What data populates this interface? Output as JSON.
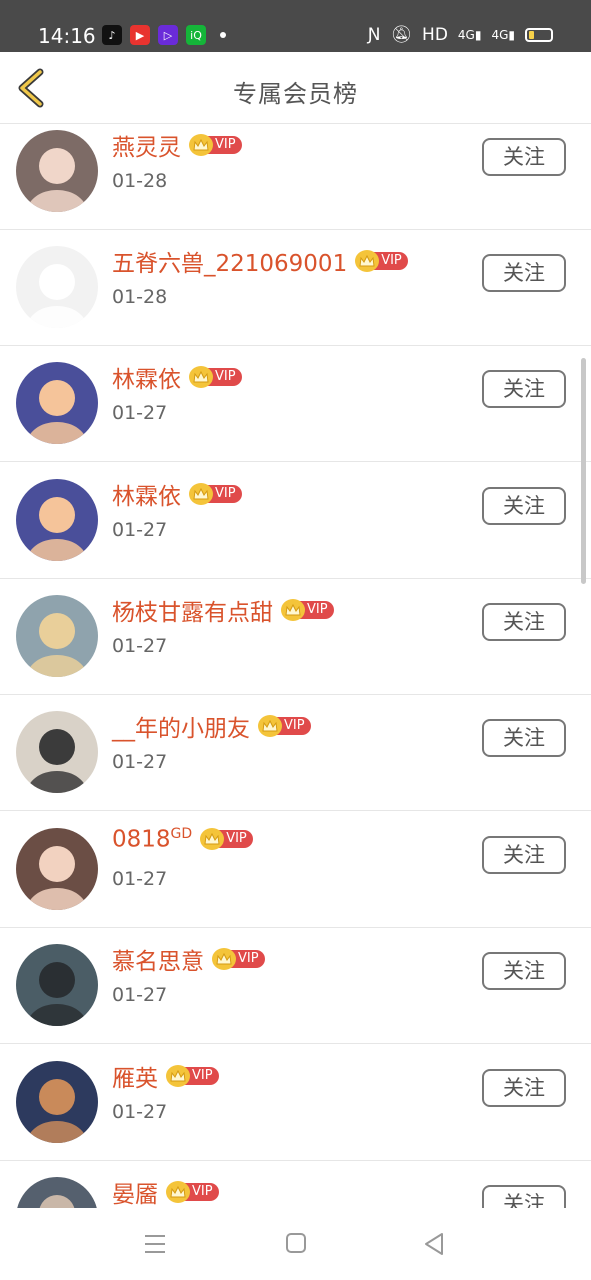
{
  "status": {
    "time": "14:16",
    "apps": [
      {
        "icon": "tiktok-icon",
        "color": "#111111",
        "glyph": "♪"
      },
      {
        "icon": "video-app-icon",
        "color": "#e8332f",
        "glyph": "▶"
      },
      {
        "icon": "music-app-icon",
        "color": "#6a2bd9",
        "glyph": "▷"
      },
      {
        "icon": "iqiyi-icon",
        "color": "#15b539",
        "glyph": "iQ"
      }
    ],
    "right_text": "HD",
    "network": "4G"
  },
  "header": {
    "title": "专属会员榜"
  },
  "vip_label": "VIP",
  "follow_label": "关注",
  "members": [
    {
      "name": "燕灵灵",
      "date": "01-28",
      "avatar_bg": "#7d6b66",
      "avatar_fg": "#f0d6c9"
    },
    {
      "name": "五脊六兽_221069001",
      "date": "01-28",
      "avatar_bg": "#f2f2f2",
      "avatar_fg": "#ffffff"
    },
    {
      "name": "林霖依",
      "date": "01-27",
      "avatar_bg": "#4a4f9a",
      "avatar_fg": "#f5c49a"
    },
    {
      "name": "林霖依",
      "date": "01-27",
      "avatar_bg": "#4a4f9a",
      "avatar_fg": "#f5c49a"
    },
    {
      "name": "杨枝甘露有点甜",
      "date": "01-27",
      "avatar_bg": "#8fa3ad",
      "avatar_fg": "#e9cf9a"
    },
    {
      "name": "__年的小朋友",
      "date": "01-27",
      "avatar_bg": "#d9d2c8",
      "avatar_fg": "#3b3b3b"
    },
    {
      "name": "0818",
      "name_sup": "GD",
      "date": "01-27",
      "avatar_bg": "#6b4e45",
      "avatar_fg": "#f2d2c0"
    },
    {
      "name": "慕名思意",
      "date": "01-27",
      "avatar_bg": "#4b5d66",
      "avatar_fg": "#2a2f33"
    },
    {
      "name": "雁英",
      "date": "01-27",
      "avatar_bg": "#2d3a5e",
      "avatar_fg": "#c98a5a"
    },
    {
      "name": "晏靥",
      "date": "",
      "avatar_bg": "#55606e",
      "avatar_fg": "#c9b7a8"
    }
  ]
}
